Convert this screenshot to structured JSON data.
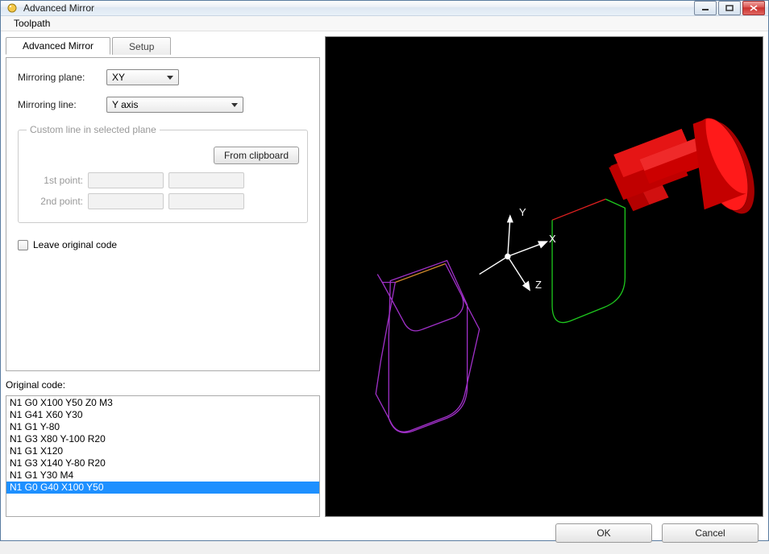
{
  "window": {
    "title": "Advanced Mirror"
  },
  "menu": {
    "toolpath": "Toolpath"
  },
  "tabs": {
    "advanced_mirror": "Advanced Mirror",
    "setup": "Setup"
  },
  "form": {
    "mirroring_plane_label": "Mirroring plane:",
    "mirroring_plane_value": "XY",
    "mirroring_line_label": "Mirroring line:",
    "mirroring_line_value": "Y axis",
    "group_legend": "Custom line in selected plane",
    "from_clipboard": "From clipboard",
    "pt1_label": "1st point:",
    "pt2_label": "2nd point:",
    "leave_original": "Leave original code"
  },
  "original_code": {
    "label": "Original code:",
    "lines": [
      "N1 G0 X100 Y50 Z0 M3",
      "N1 G41 X60 Y30",
      "N1 G1 Y-80",
      "N1 G3 X80 Y-100 R20",
      "N1 G1 X120",
      "N1 G3 X140 Y-80 R20",
      "N1 G1 Y30 M4",
      "N1 G0 G40 X100 Y50"
    ],
    "selected_index": 7
  },
  "axes": {
    "x": "X",
    "y": "Y",
    "z": "Z"
  },
  "buttons": {
    "ok": "OK",
    "cancel": "Cancel"
  }
}
